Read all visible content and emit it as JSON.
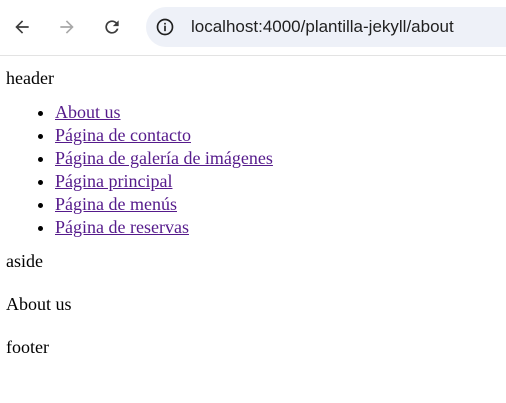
{
  "browser": {
    "url": "localhost:4000/plantilla-jekyll/about"
  },
  "page": {
    "header": "header",
    "nav_links": [
      "About us",
      "Página de contacto",
      "Página de galería de imágenes",
      "Página principal",
      "Página de menús",
      "Página de reservas"
    ],
    "aside": "aside",
    "main": "About us",
    "footer": "footer"
  },
  "colors": {
    "link_visited": "#551a8b",
    "omnibox_bg": "#eef1f8"
  },
  "icons": [
    "back-arrow-icon",
    "forward-arrow-icon",
    "reload-icon",
    "info-icon"
  ]
}
